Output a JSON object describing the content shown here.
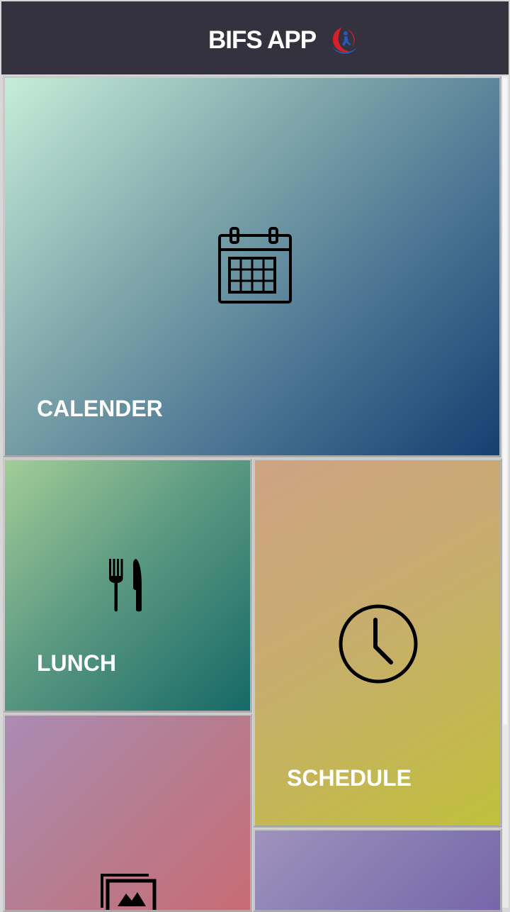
{
  "header": {
    "title": "BIFS APP",
    "logo_icon": "bifs-logo-icon"
  },
  "tiles": {
    "calendar": {
      "label": "CALENDER",
      "icon": "calendar-icon"
    },
    "lunch": {
      "label": "LUNCH",
      "icon": "fork-knife-icon"
    },
    "schedule": {
      "label": "SCHEDULE",
      "icon": "clock-icon"
    },
    "gallery": {
      "label": "",
      "icon": "gallery-icon"
    },
    "extra": {
      "label": "",
      "icon": ""
    }
  },
  "colors": {
    "header_bg": "#33323e",
    "calendar_gradient": [
      "#c6ecd9",
      "#153f70"
    ],
    "lunch_gradient": [
      "#a2cd98",
      "#166967"
    ],
    "schedule_gradient": [
      "#cea384",
      "#c0c03c"
    ],
    "gallery_gradient": [
      "#ab8bb4",
      "#c86c75"
    ],
    "extra_gradient": [
      "#9f92bd",
      "#7865aa"
    ]
  }
}
